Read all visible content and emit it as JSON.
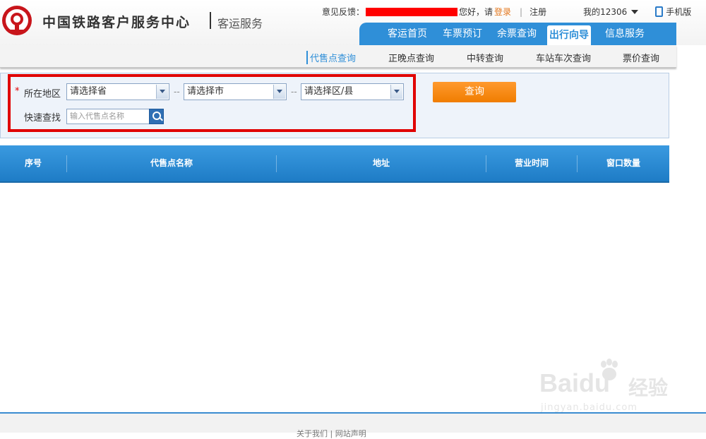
{
  "header": {
    "brand_title": "中国铁路客户服务中心",
    "brand_sub": "客运服务",
    "feedback_label": "意见反馈：",
    "greeting": "您好，请",
    "login": "登录",
    "register": "注册",
    "my_account": "我的12306",
    "mobile": "手机版"
  },
  "main_nav": {
    "items": [
      {
        "label": "客运首页"
      },
      {
        "label": "车票预订"
      },
      {
        "label": "余票查询"
      },
      {
        "label": "出行向导"
      },
      {
        "label": "信息服务"
      }
    ],
    "active_index": 3
  },
  "sub_nav": {
    "items": [
      {
        "label": "代售点查询"
      },
      {
        "label": "正晚点查询"
      },
      {
        "label": "中转查询"
      },
      {
        "label": "车站车次查询"
      },
      {
        "label": "票价查询"
      }
    ],
    "active_index": 0
  },
  "query": {
    "required_mark": "*",
    "region_label": "所在地区",
    "province_value": "请选择省",
    "city_value": "请选择市",
    "district_value": "请选择区/县",
    "separator": "--",
    "quick_search_label": "快速查找",
    "quick_search_placeholder": "输入代售点名称",
    "submit_label": "查询"
  },
  "table": {
    "columns": [
      "序号",
      "代售点名称",
      "地址",
      "营业时间",
      "窗口数量"
    ],
    "rows": []
  },
  "footer": {
    "links": "关于我们 | 网站声明"
  },
  "watermark": {
    "url": "jingyan.baidu.com"
  },
  "colors": {
    "nav_blue": "#2f8fd8",
    "query_orange": "#f07d00",
    "highlight_red": "#e00000",
    "login_orange": "#e3761b"
  }
}
